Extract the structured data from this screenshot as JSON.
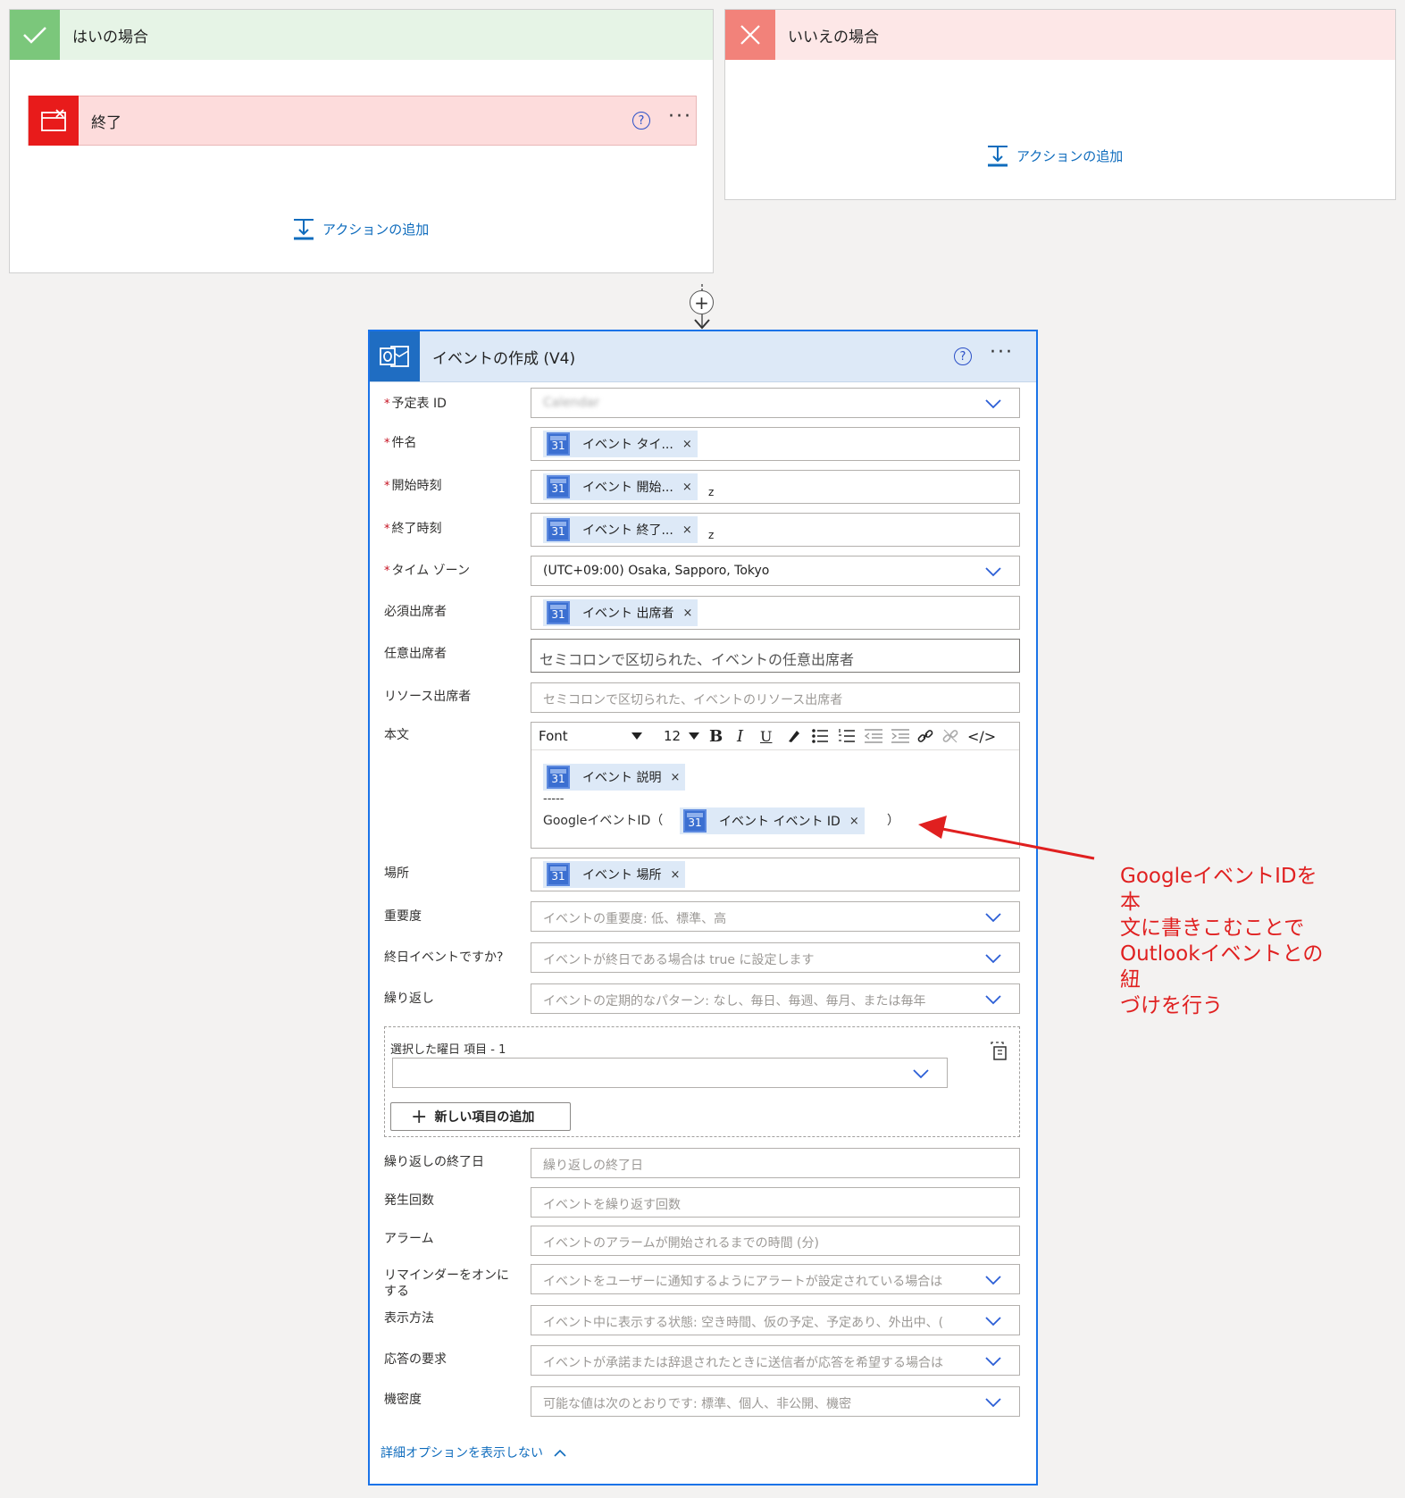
{
  "yes_branch": {
    "title": "はいの場合",
    "end_action_label": "終了",
    "add_action_label": "アクションの追加"
  },
  "no_branch": {
    "title": "いいえの場合",
    "add_action_label": "アクションの追加"
  },
  "colors": {
    "yes_header": "#e6f4e6",
    "yes_icon": "#7bc77b",
    "no_header": "#fde7e7",
    "no_icon": "#f2827a",
    "end_icon": "#e81b1b",
    "accent": "#1a73e8",
    "annotation": "#e02020"
  },
  "action_card": {
    "title": "イベントの作成 (V4)",
    "fields": {
      "calendar_id": {
        "label": "予定表 ID",
        "value": "Calendar"
      },
      "subject": {
        "label": "件名",
        "token": "イベント タイ..."
      },
      "start_time": {
        "label": "開始時刻",
        "token": "イベント 開始...",
        "suffix": "z"
      },
      "end_time": {
        "label": "終了時刻",
        "token": "イベント 終了...",
        "suffix": "z"
      },
      "time_zone": {
        "label": "タイム ゾーン",
        "value": "(UTC+09:00) Osaka, Sapporo, Tokyo"
      },
      "required_attendees": {
        "label": "必須出席者",
        "token": "イベント 出席者"
      },
      "optional_attendees": {
        "label": "任意出席者",
        "placeholder": "セミコロンで区切られた、イベントの任意出席者"
      },
      "resource_attendees": {
        "label": "リソース出席者",
        "placeholder": "セミコロンで区切られた、イベントのリソース出席者"
      },
      "body": {
        "label": "本文",
        "font": "Font",
        "size": "12",
        "token_description": "イベント 説明",
        "separator": "-----",
        "google_id_prefix": "GoogleイベントID（",
        "token_event_id": "イベント イベント ID",
        "google_id_suffix": "）"
      },
      "location": {
        "label": "場所",
        "token": "イベント 場所"
      },
      "importance": {
        "label": "重要度",
        "placeholder": "イベントの重要度: 低、標準、高"
      },
      "all_day": {
        "label": "終日イベントですか?",
        "placeholder": "イベントが終日である場合は true に設定します"
      },
      "recurrence": {
        "label": "繰り返し",
        "placeholder": "イベントの定期的なパターン: なし、毎日、毎週、毎月、または毎年"
      },
      "weekday_group": {
        "label": "選択した曜日 項目 - 1",
        "add_item_label": "新しい項目の追加"
      },
      "recurrence_end": {
        "label": "繰り返しの終了日",
        "placeholder": "繰り返しの終了日"
      },
      "occurrences": {
        "label": "発生回数",
        "placeholder": "イベントを繰り返す回数"
      },
      "alarm": {
        "label": "アラーム",
        "placeholder": "イベントのアラームが開始されるまでの時間 (分)"
      },
      "reminder": {
        "label_line1": "リマインダーをオンに",
        "label_line2": "する",
        "placeholder": "イベントをユーザーに通知するようにアラートが設定されている場合は"
      },
      "show_as": {
        "label": "表示方法",
        "placeholder": "イベント中に表示する状態: 空き時間、仮の予定、予定あり、外出中、("
      },
      "response_requested": {
        "label": "応答の要求",
        "placeholder": "イベントが承諾または辞退されたときに送信者が応答を希望する場合は"
      },
      "sensitivity": {
        "label": "機密度",
        "placeholder": "可能な値は次のとおりです: 標準、個人、非公開、機密"
      }
    },
    "hide_advanced_label": "詳細オプションを表示しない"
  },
  "annotation": {
    "line1": "GoogleイベントIDを本",
    "line2": "文に書きこむことで",
    "line3": "Outlookイベントとの紐",
    "line4": "づけを行う"
  }
}
